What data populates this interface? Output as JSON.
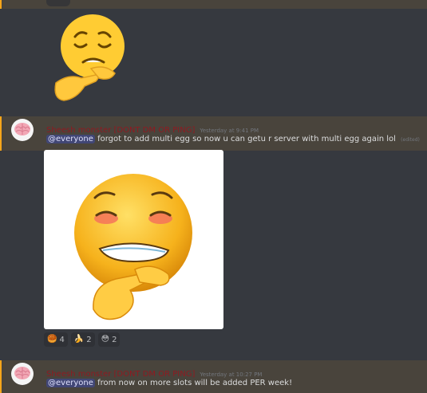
{
  "messages": [
    {
      "author": "Sheesh monster [DONT DM OR PING]",
      "timestamp": "Yesterday at 9:41 PM",
      "mention": "@everyone",
      "text": "forgot to add multi egg so now u can getu r server with multi egg again lol",
      "edited": "(edited)",
      "reactions": [
        {
          "emoji": "🥮",
          "count": "4"
        },
        {
          "emoji": "🍌",
          "count": "2"
        },
        {
          "emoji": "😳",
          "count": "2"
        }
      ]
    },
    {
      "author": "Sheesh monster [DONT DM OR PING]",
      "timestamp": "Yesterday at 10:27 PM",
      "mention": "@everyone",
      "text": "from now on more slots will be added PER week!"
    }
  ],
  "colors": {
    "background": "#36393f",
    "mention_highlight": "#49443c",
    "mention_bar": "#faa61a",
    "author": "#8e1b21",
    "text": "#dcddde",
    "timestamp": "#72767d",
    "mention_pill": "#414675",
    "reaction_bg": "#2f3136"
  },
  "icons": [
    "pleading-emoji-icon",
    "brain-avatar-icon",
    "flushed-biting-lip-emoji-icon"
  ]
}
